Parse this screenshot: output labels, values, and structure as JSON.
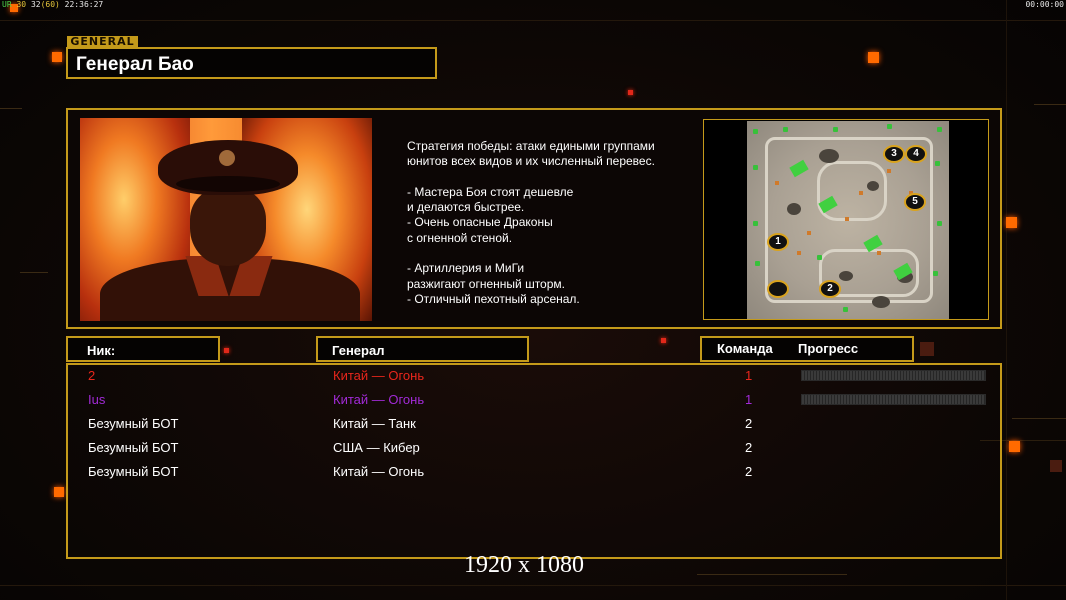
{
  "hud": {
    "fps_a": "UR",
    "fps_b": "30",
    "fps_c": "32",
    "fps_d": "(60)",
    "clock": "22:36:27",
    "timer": "00:00:00"
  },
  "general": {
    "tag": "GENERAL",
    "name": "Генерал Бао",
    "description": "Стратегия победы: атаки едиными группами\nюнитов всех видов и их численный перевес.\n\n- Мастера Боя стоят дешевле\nи делаются быстрее.\n- Очень опасные Драконы\nс огненной стеной.\n\n- Артиллерия и МиГи\nразжигают огненный шторм.\n- Отличный пехотный арсенал."
  },
  "map": {
    "start_positions": [
      "1",
      "2",
      "3",
      "4",
      "5"
    ]
  },
  "columns": {
    "nick": "Ник:",
    "general": "Генерал",
    "team": "Команда",
    "progress": "Прогресс"
  },
  "players": [
    {
      "nick": "2",
      "general": "Китай — Огонь",
      "team": "1",
      "color": "#e8261c"
    },
    {
      "nick": "Ius",
      "general": "Китай — Огонь",
      "team": "1",
      "color": "#a12ad6"
    },
    {
      "nick": "Безумный БОТ",
      "general": "Китай — Танк",
      "team": "2",
      "color": "#ffffff"
    },
    {
      "nick": "Безумный БОТ",
      "general": "США — Кибер",
      "team": "2",
      "color": "#ffffff"
    },
    {
      "nick": "Безумный БОТ",
      "general": "Китай — Огонь",
      "team": "2",
      "color": "#ffffff"
    }
  ],
  "overlay": {
    "resolution": "1920 x 1080"
  },
  "colors": {
    "gold": "#c49a1a",
    "accent": "#ff6a00"
  }
}
